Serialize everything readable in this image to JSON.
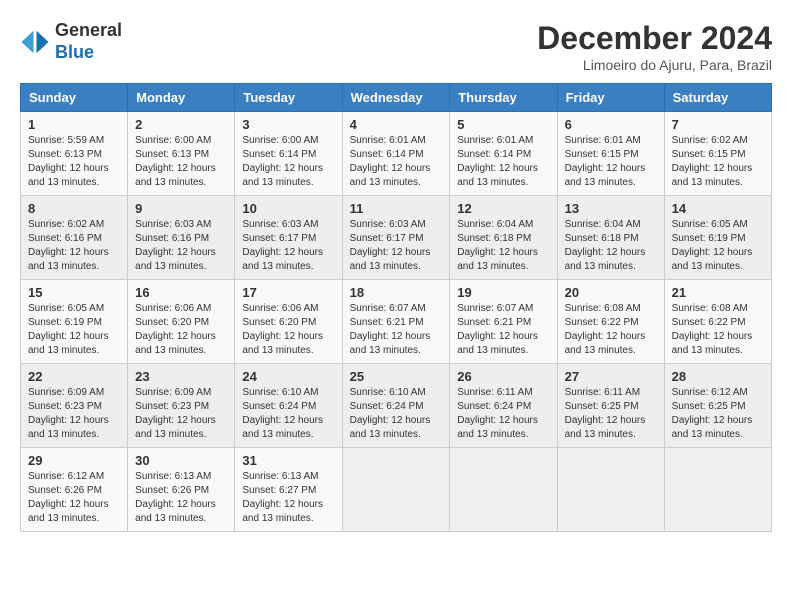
{
  "logo": {
    "general": "General",
    "blue": "Blue"
  },
  "title": "December 2024",
  "location": "Limoeiro do Ajuru, Para, Brazil",
  "days_of_week": [
    "Sunday",
    "Monday",
    "Tuesday",
    "Wednesday",
    "Thursday",
    "Friday",
    "Saturday"
  ],
  "weeks": [
    [
      {
        "day": "1",
        "sunrise": "5:59 AM",
        "sunset": "6:13 PM",
        "daylight": "12 hours and 13 minutes."
      },
      {
        "day": "2",
        "sunrise": "6:00 AM",
        "sunset": "6:13 PM",
        "daylight": "12 hours and 13 minutes."
      },
      {
        "day": "3",
        "sunrise": "6:00 AM",
        "sunset": "6:14 PM",
        "daylight": "12 hours and 13 minutes."
      },
      {
        "day": "4",
        "sunrise": "6:01 AM",
        "sunset": "6:14 PM",
        "daylight": "12 hours and 13 minutes."
      },
      {
        "day": "5",
        "sunrise": "6:01 AM",
        "sunset": "6:14 PM",
        "daylight": "12 hours and 13 minutes."
      },
      {
        "day": "6",
        "sunrise": "6:01 AM",
        "sunset": "6:15 PM",
        "daylight": "12 hours and 13 minutes."
      },
      {
        "day": "7",
        "sunrise": "6:02 AM",
        "sunset": "6:15 PM",
        "daylight": "12 hours and 13 minutes."
      }
    ],
    [
      {
        "day": "8",
        "sunrise": "6:02 AM",
        "sunset": "6:16 PM",
        "daylight": "12 hours and 13 minutes."
      },
      {
        "day": "9",
        "sunrise": "6:03 AM",
        "sunset": "6:16 PM",
        "daylight": "12 hours and 13 minutes."
      },
      {
        "day": "10",
        "sunrise": "6:03 AM",
        "sunset": "6:17 PM",
        "daylight": "12 hours and 13 minutes."
      },
      {
        "day": "11",
        "sunrise": "6:03 AM",
        "sunset": "6:17 PM",
        "daylight": "12 hours and 13 minutes."
      },
      {
        "day": "12",
        "sunrise": "6:04 AM",
        "sunset": "6:18 PM",
        "daylight": "12 hours and 13 minutes."
      },
      {
        "day": "13",
        "sunrise": "6:04 AM",
        "sunset": "6:18 PM",
        "daylight": "12 hours and 13 minutes."
      },
      {
        "day": "14",
        "sunrise": "6:05 AM",
        "sunset": "6:19 PM",
        "daylight": "12 hours and 13 minutes."
      }
    ],
    [
      {
        "day": "15",
        "sunrise": "6:05 AM",
        "sunset": "6:19 PM",
        "daylight": "12 hours and 13 minutes."
      },
      {
        "day": "16",
        "sunrise": "6:06 AM",
        "sunset": "6:20 PM",
        "daylight": "12 hours and 13 minutes."
      },
      {
        "day": "17",
        "sunrise": "6:06 AM",
        "sunset": "6:20 PM",
        "daylight": "12 hours and 13 minutes."
      },
      {
        "day": "18",
        "sunrise": "6:07 AM",
        "sunset": "6:21 PM",
        "daylight": "12 hours and 13 minutes."
      },
      {
        "day": "19",
        "sunrise": "6:07 AM",
        "sunset": "6:21 PM",
        "daylight": "12 hours and 13 minutes."
      },
      {
        "day": "20",
        "sunrise": "6:08 AM",
        "sunset": "6:22 PM",
        "daylight": "12 hours and 13 minutes."
      },
      {
        "day": "21",
        "sunrise": "6:08 AM",
        "sunset": "6:22 PM",
        "daylight": "12 hours and 13 minutes."
      }
    ],
    [
      {
        "day": "22",
        "sunrise": "6:09 AM",
        "sunset": "6:23 PM",
        "daylight": "12 hours and 13 minutes."
      },
      {
        "day": "23",
        "sunrise": "6:09 AM",
        "sunset": "6:23 PM",
        "daylight": "12 hours and 13 minutes."
      },
      {
        "day": "24",
        "sunrise": "6:10 AM",
        "sunset": "6:24 PM",
        "daylight": "12 hours and 13 minutes."
      },
      {
        "day": "25",
        "sunrise": "6:10 AM",
        "sunset": "6:24 PM",
        "daylight": "12 hours and 13 minutes."
      },
      {
        "day": "26",
        "sunrise": "6:11 AM",
        "sunset": "6:24 PM",
        "daylight": "12 hours and 13 minutes."
      },
      {
        "day": "27",
        "sunrise": "6:11 AM",
        "sunset": "6:25 PM",
        "daylight": "12 hours and 13 minutes."
      },
      {
        "day": "28",
        "sunrise": "6:12 AM",
        "sunset": "6:25 PM",
        "daylight": "12 hours and 13 minutes."
      }
    ],
    [
      {
        "day": "29",
        "sunrise": "6:12 AM",
        "sunset": "6:26 PM",
        "daylight": "12 hours and 13 minutes."
      },
      {
        "day": "30",
        "sunrise": "6:13 AM",
        "sunset": "6:26 PM",
        "daylight": "12 hours and 13 minutes."
      },
      {
        "day": "31",
        "sunrise": "6:13 AM",
        "sunset": "6:27 PM",
        "daylight": "12 hours and 13 minutes."
      },
      null,
      null,
      null,
      null
    ]
  ]
}
